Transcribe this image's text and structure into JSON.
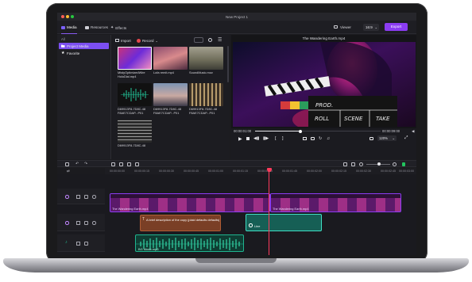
{
  "window": {
    "title": "New Project 1"
  },
  "nav": {
    "tabs": [
      {
        "label": "Media",
        "active": true
      },
      {
        "label": "Resources",
        "active": false
      },
      {
        "label": "Effects",
        "active": false
      }
    ],
    "viewer_label": "Viewer",
    "aspect_ratio": "16:9",
    "export_label": "Export"
  },
  "sidebar": {
    "all_label": "All",
    "items": [
      {
        "label": "Project Media",
        "selected": true
      },
      {
        "label": "Favorite",
        "selected": false
      }
    ]
  },
  "media_toolbar": {
    "import_label": "Import",
    "record_label": "Record"
  },
  "media_items": [
    {
      "caption": "MistyOptimizedWire HoloDial.mp4"
    },
    {
      "caption": "Lofa remit.mp4"
    },
    {
      "caption": "SoundMusic.mov"
    },
    {
      "caption": "D69913F8-7D8C-48 F8AE7CDAP...P01"
    },
    {
      "caption": "D69913F8-7D8C-48 F8AE7CDAP...P01"
    },
    {
      "caption": "D69913F8-7D8C-48 F8AE7CDAP...P01"
    },
    {
      "caption": "D69913F8-7D8C-48"
    }
  ],
  "preview": {
    "title": "The Wandering Earth.mp4",
    "clapper": [
      "PROD.",
      "ROLL",
      "SCENE",
      "TAKE"
    ],
    "time_current": "00:00:01:00",
    "time_total": "00:00:09:00",
    "zoom": "120%"
  },
  "timeline": {
    "ruler": [
      "00:00:00:00",
      "00:00:00:15",
      "00:00:00:30",
      "00:00:00:45",
      "00:00:01:00",
      "00:00:01:15",
      "00:00:01:30",
      "00:00:01:45",
      "00:00:02:00",
      "00:00:02:15",
      "00:00:02:30",
      "00:00:02:45",
      "00:00:03:00"
    ],
    "video_clip_1": "The Wandering Earth.mp4",
    "video_clip_2": "The Wandering Earth.mp4",
    "text_clip": "A brief description of the copy (plaid defaults defaults)",
    "title_clip": "Line",
    "audio_clip": "BG Music.mp3"
  },
  "colors": {
    "accent": "#8b3cf2",
    "playhead": "#ff3b5c",
    "audio": "#1fb58f",
    "title_clip": "#1c8b78",
    "text_clip": "#b05c34"
  }
}
